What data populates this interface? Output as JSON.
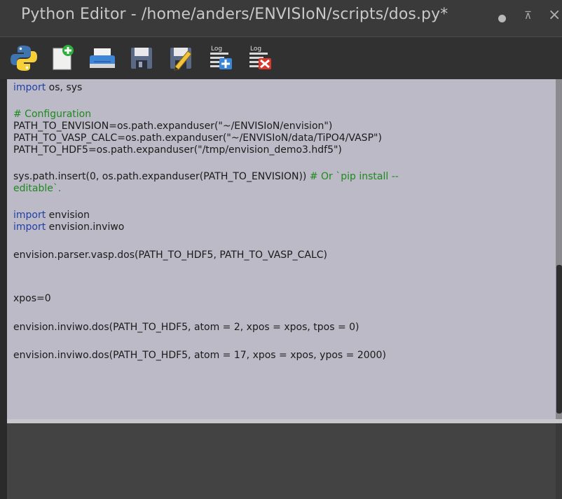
{
  "window": {
    "title": "Python Editor - /home/anders/ENVISIoN/scripts/dos.py*",
    "pin_glyph": "⊼",
    "close_glyph": "×"
  },
  "toolbar": {
    "buttons": [
      {
        "icon": "python-logo-icon",
        "action": "run-script"
      },
      {
        "icon": "new-file-icon",
        "action": "new"
      },
      {
        "icon": "open-folder-icon",
        "action": "open"
      },
      {
        "icon": "save-icon",
        "action": "save"
      },
      {
        "icon": "save-as-edit-icon",
        "action": "save-as"
      },
      {
        "icon": "log-append-icon",
        "label": "Log",
        "action": "append-log"
      },
      {
        "icon": "log-clear-icon",
        "label": "Log",
        "action": "clear-log"
      }
    ]
  },
  "editor": {
    "lines": [
      {
        "kw": "import",
        "text": " os, sys"
      },
      {
        "comment": "# Configuration"
      },
      {
        "text": "PATH_TO_ENVISION=os.path.expanduser(\"~/ENVISIoN/envision\")"
      },
      {
        "text": "PATH_TO_VASP_CALC=os.path.expanduser(\"~/ENVISIoN/data/TiPO4/VASP\")"
      },
      {
        "text": "PATH_TO_HDF5=os.path.expanduser(\"/tmp/envision_demo3.hdf5\")"
      },
      {
        "text": "sys.path.insert(0, os.path.expanduser(PATH_TO_ENVISION)) ",
        "comment": "# Or `pip install --"
      },
      {
        "comment": "editable`."
      },
      {
        "kw": "import",
        "text": " envision"
      },
      {
        "kw": "import",
        "text": " envision.inviwo"
      },
      {
        "text": "envision.parser.vasp.dos(PATH_TO_HDF5, PATH_TO_VASP_CALC)"
      },
      {
        "text": "xpos=0"
      },
      {
        "text": "envision.inviwo.dos(PATH_TO_HDF5, atom = 2, xpos = xpos, tpos = 0)"
      },
      {
        "text": "envision.inviwo.dos(PATH_TO_HDF5, atom = 17, xpos = xpos, ypos = 2000)"
      }
    ]
  },
  "colors": {
    "editor_bg": "#bbbac6",
    "keyword": "#2241a8",
    "comment": "#1e8a1e",
    "titlebar_bg": "#3a3a3a"
  }
}
